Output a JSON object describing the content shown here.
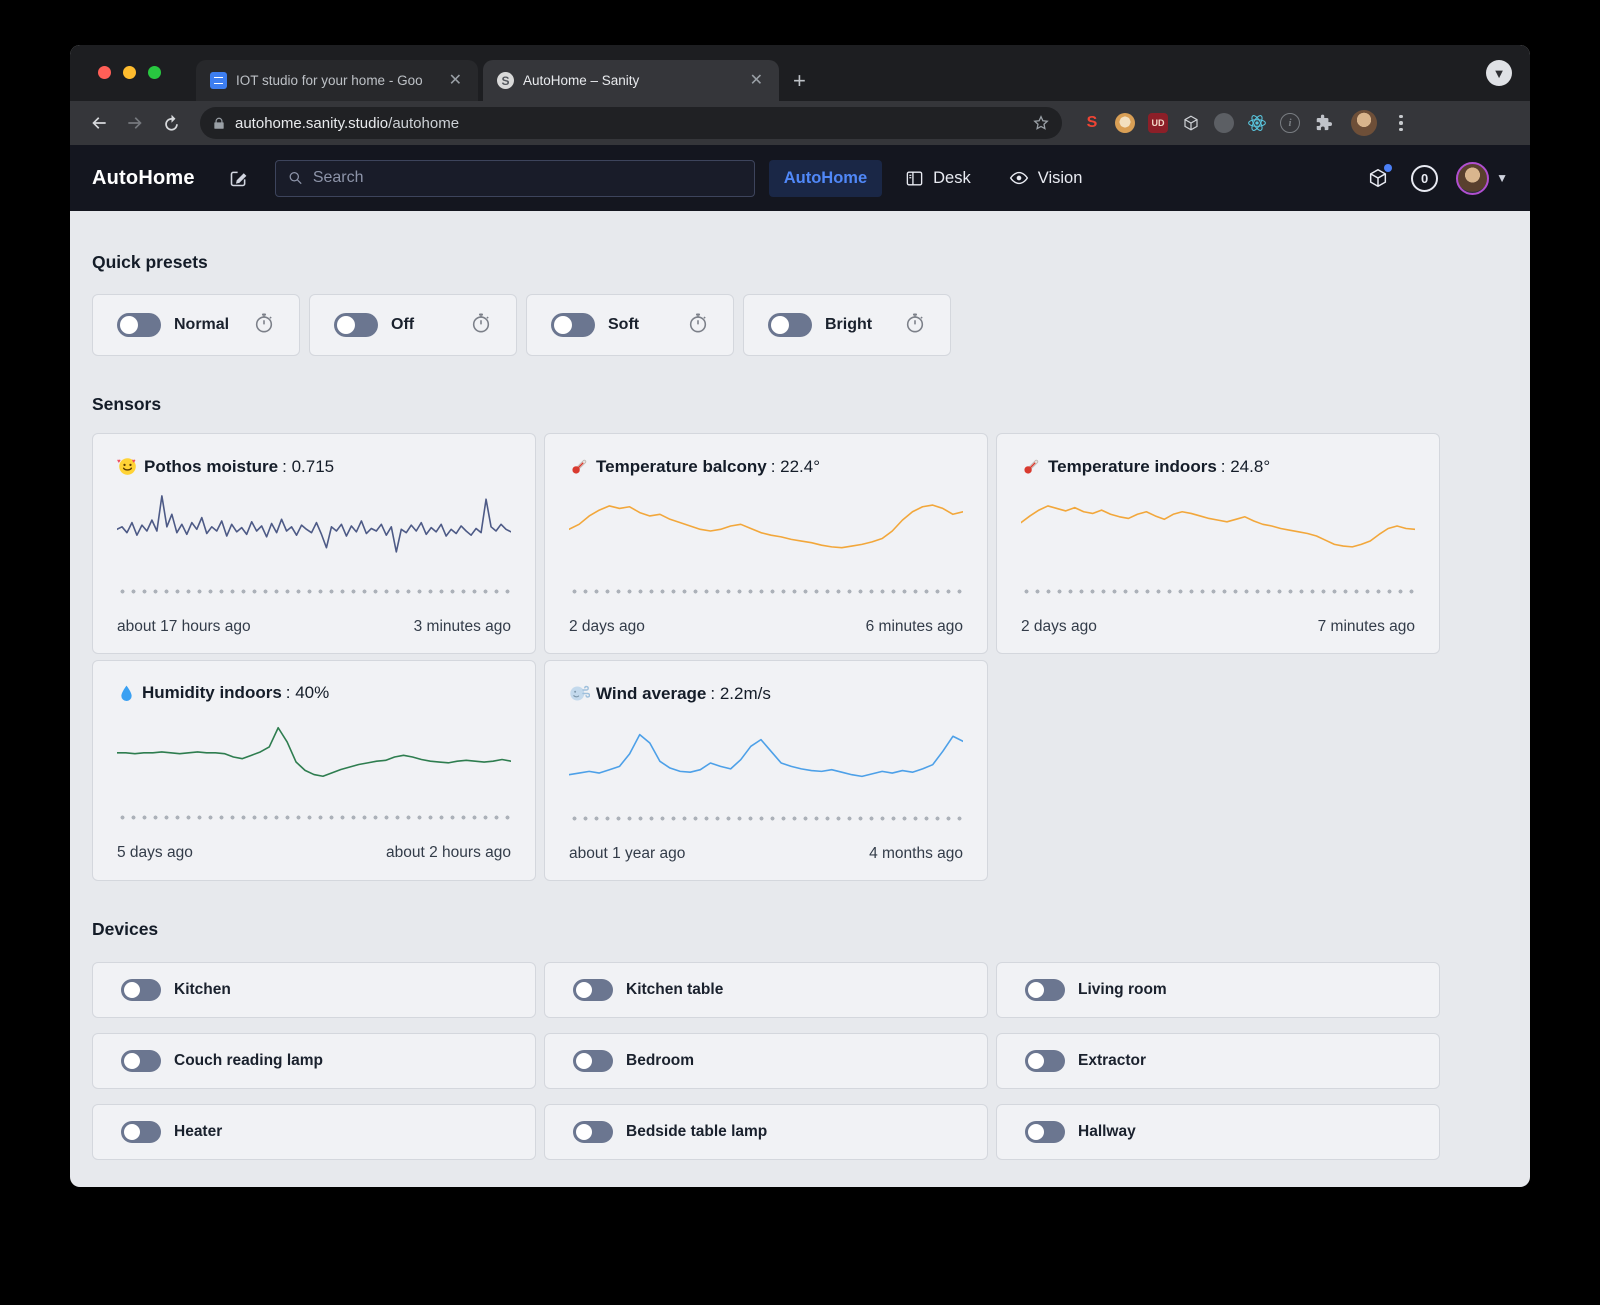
{
  "browser": {
    "tabs": [
      {
        "title": "IOT studio for your home - Goo"
      },
      {
        "title": "AutoHome – Sanity"
      }
    ],
    "url_host": "autohome.sanity.studio",
    "url_path": "/autohome"
  },
  "header": {
    "title": "AutoHome",
    "search_placeholder": "Search",
    "nav": [
      {
        "label": "AutoHome"
      },
      {
        "label": "Desk"
      },
      {
        "label": "Vision"
      }
    ],
    "badge_count": "0"
  },
  "presets": {
    "heading": "Quick presets",
    "items": [
      {
        "label": "Normal"
      },
      {
        "label": "Off"
      },
      {
        "label": "Soft"
      },
      {
        "label": "Bright"
      }
    ]
  },
  "sensors": {
    "heading": "Sensors",
    "cards": [
      {
        "icon": "heart-face",
        "name": "Pothos moisture",
        "value": "0.715",
        "from": "about 17 hours ago",
        "to": "3 minutes ago"
      },
      {
        "icon": "thermometer",
        "name": "Temperature balcony",
        "value": "22.4°",
        "from": "2 days ago",
        "to": "6 minutes ago"
      },
      {
        "icon": "thermometer",
        "name": "Temperature indoors",
        "value": "24.8°",
        "from": "2 days ago",
        "to": "7 minutes ago"
      },
      {
        "icon": "droplet",
        "name": "Humidity indoors",
        "value": "40%",
        "from": "5 days ago",
        "to": "about 2 hours ago"
      },
      {
        "icon": "wind",
        "name": "Wind average",
        "value": "2.2m/s",
        "from": "about 1 year ago",
        "to": "4 months ago"
      }
    ]
  },
  "devices": {
    "heading": "Devices",
    "items": [
      {
        "label": "Kitchen"
      },
      {
        "label": "Kitchen table"
      },
      {
        "label": "Living room"
      },
      {
        "label": "Couch reading lamp"
      },
      {
        "label": "Bedroom"
      },
      {
        "label": "Extractor"
      },
      {
        "label": "Heater"
      },
      {
        "label": "Bedside table lamp"
      },
      {
        "label": "Hallway"
      }
    ]
  },
  "chart_data": [
    {
      "type": "line",
      "name": "Pothos moisture",
      "color": "#4d5a86",
      "ylim": [
        0,
        100
      ],
      "values": [
        52,
        55,
        48,
        60,
        45,
        57,
        50,
        63,
        50,
        92,
        55,
        70,
        48,
        58,
        46,
        60,
        52,
        66,
        47,
        55,
        50,
        62,
        44,
        58,
        49,
        54,
        46,
        61,
        50,
        56,
        43,
        59,
        48,
        64,
        50,
        55,
        45,
        57,
        52,
        48,
        60,
        46,
        30,
        55,
        50,
        58,
        44,
        56,
        49,
        62,
        47,
        53,
        50,
        58,
        45,
        55,
        25,
        52,
        48,
        57,
        50,
        60,
        46,
        54,
        49,
        58,
        44,
        52,
        47,
        56,
        50,
        45,
        53,
        48,
        88,
        55,
        50,
        58,
        52,
        49
      ]
    },
    {
      "type": "line",
      "name": "Temperature balcony",
      "color": "#f2a73b",
      "ylim": [
        0,
        100
      ],
      "values": [
        52,
        58,
        68,
        75,
        80,
        77,
        79,
        72,
        68,
        70,
        64,
        60,
        56,
        52,
        50,
        52,
        56,
        58,
        53,
        48,
        45,
        43,
        40,
        38,
        36,
        33,
        31,
        30,
        32,
        34,
        37,
        41,
        50,
        63,
        73,
        79,
        81,
        77,
        70,
        73
      ]
    },
    {
      "type": "line",
      "name": "Temperature indoors",
      "color": "#f2a73b",
      "ylim": [
        0,
        100
      ],
      "values": [
        60,
        68,
        75,
        80,
        77,
        74,
        78,
        73,
        71,
        75,
        70,
        67,
        65,
        70,
        73,
        68,
        64,
        70,
        73,
        71,
        68,
        65,
        63,
        61,
        64,
        67,
        62,
        58,
        56,
        53,
        51,
        49,
        47,
        44,
        39,
        34,
        32,
        31,
        34,
        38,
        46,
        53,
        56,
        53,
        52
      ]
    },
    {
      "type": "line",
      "name": "Humidity indoors",
      "color": "#2e7d4f",
      "ylim": [
        0,
        100
      ],
      "values": [
        55,
        55,
        54,
        55,
        55,
        56,
        55,
        54,
        55,
        56,
        55,
        55,
        54,
        50,
        48,
        52,
        56,
        62,
        85,
        68,
        44,
        34,
        29,
        27,
        31,
        35,
        38,
        41,
        43,
        45,
        46,
        50,
        52,
        50,
        47,
        45,
        44,
        43,
        45,
        46,
        45,
        44,
        45,
        47,
        45
      ]
    },
    {
      "type": "line",
      "name": "Wind average",
      "color": "#4da0e8",
      "ylim": [
        0,
        100
      ],
      "values": [
        30,
        32,
        34,
        32,
        36,
        40,
        55,
        78,
        68,
        46,
        38,
        34,
        33,
        36,
        44,
        40,
        37,
        48,
        64,
        72,
        58,
        44,
        40,
        37,
        35,
        34,
        36,
        33,
        30,
        28,
        31,
        34,
        32,
        35,
        33,
        37,
        42,
        58,
        76,
        70
      ]
    }
  ]
}
